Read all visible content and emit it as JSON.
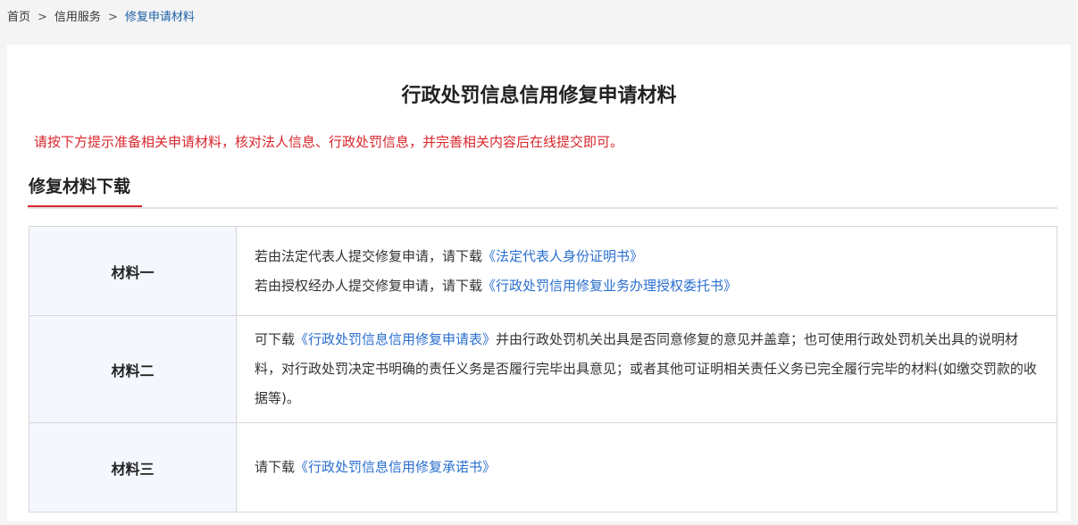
{
  "breadcrumb": {
    "home": "首页",
    "separator": ">",
    "section": "信用服务",
    "current": "修复申请材料"
  },
  "page": {
    "title": "行政处罚信息信用修复申请材料",
    "notice": "请按下方提示准备相关申请材料，核对法人信息、行政处罚信息，并完善相关内容后在线提交即可。",
    "section_title": "修复材料下载"
  },
  "materials": [
    {
      "label": "材料一",
      "lines": [
        {
          "prefix": "若由法定代表人提交修复申请，请下载",
          "link": "《法定代表人身份证明书》"
        },
        {
          "prefix": "若由授权经办人提交修复申请，请下载",
          "link": "《行政处罚信用修复业务办理授权委托书》"
        }
      ]
    },
    {
      "label": "材料二",
      "prefix": "可下载",
      "link": "《行政处罚信息信用修复申请表》",
      "suffix": "并由行政处罚机关出具是否同意修复的意见并盖章；也可使用行政处罚机关出具的说明材料，对行政处罚决定书明确的责任义务是否履行完毕出具意见；或者其他可证明相关责任义务已完全履行完毕的材料(如缴交罚款的收据等)。"
    },
    {
      "label": "材料三",
      "prefix": "请下载",
      "link": "《行政处罚信息信用修复承诺书》"
    }
  ],
  "colors": {
    "link": "#2a6fcf",
    "notice": "#d9262c",
    "accent": "#d9262c"
  }
}
